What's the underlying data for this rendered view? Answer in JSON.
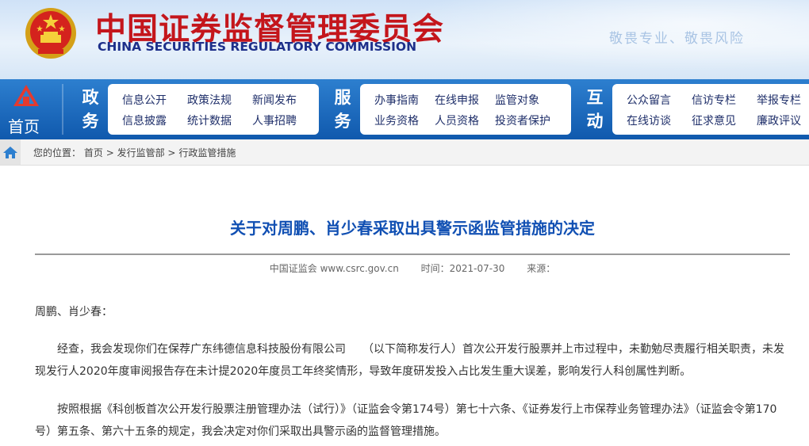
{
  "header": {
    "cn_title": "中国证券监督管理委员会",
    "en_title": "CHINA SECURITIES REGULATORY COMMISSION",
    "slogan": "敬畏专业、敬畏风险"
  },
  "nav": {
    "home_label": "首页",
    "groups": [
      {
        "category": [
          "政",
          "务"
        ],
        "items": [
          "信息公开",
          "政策法规",
          "新闻发布",
          "信息披露",
          "统计数据",
          "人事招聘"
        ]
      },
      {
        "category": [
          "服",
          "务"
        ],
        "items": [
          "办事指南",
          "在线申报",
          "监管对象",
          "业务资格",
          "人员资格",
          "投资者保护"
        ]
      },
      {
        "category": [
          "互",
          "动"
        ],
        "items": [
          "公众留言",
          "信访专栏",
          "举报专栏",
          "在线访谈",
          "征求意见",
          "廉政评议"
        ]
      }
    ]
  },
  "breadcrumb": {
    "prefix": "您的位置：",
    "items": [
      "首页",
      "发行监管部",
      "行政监管措施"
    ],
    "separator": ">"
  },
  "article": {
    "title": "关于对周鹏、肖少春采取出具警示函监管措施的决定",
    "source": "中国证监会 www.csrc.gov.cn",
    "time": "时间：2021-07-30",
    "origin": "来源：",
    "salutation": "周鹏、肖少春：",
    "paragraph1": "经查，我会发现你们在保荐广东纬德信息科技股份有限公司　　（以下简称发行人）首次公开发行股票并上市过程中，未勤勉尽责履行相关职责，未发现发行人2020年度审阅报告存在未计提2020年度员工年终奖情形，导致年度研发投入占比发生重大误差，影响发行人科创属性判断。",
    "paragraph2": "按照根据《科创板首次公开发行股票注册管理办法（试行）》（证监会令第174号）第七十六条、《证券发行上市保荐业务管理办法》（证监会令第170号）第五条、第六十五条的规定，我会决定对你们采取出具警示函的监督管理措施。"
  }
}
